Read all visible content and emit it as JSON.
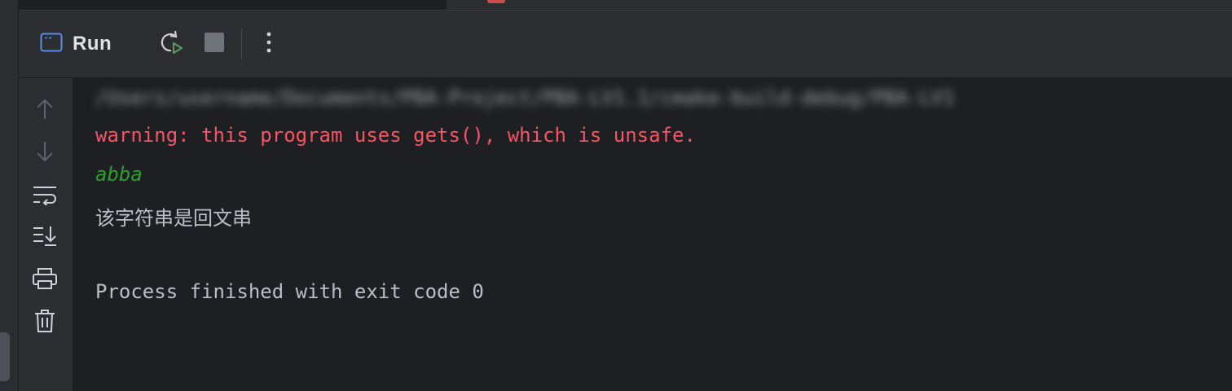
{
  "toolwindow": {
    "title": "Run",
    "icons": {
      "title": "console-window-icon",
      "rerun": "rerun-icon",
      "stop": "stop-icon",
      "more": "more-vertical-icon"
    }
  },
  "gutter": {
    "icons": [
      "arrow-up-icon",
      "arrow-down-icon",
      "soft-wrap-icon",
      "scroll-to-end-icon",
      "print-icon",
      "trash-icon"
    ]
  },
  "console": {
    "command_line": "/Users/username/Documents/PBA-Project/PBA-LV1.1/cmake-build-debug/PBA-LV1",
    "lines": {
      "warning": "warning: this program uses gets(), which is unsafe.",
      "input": "abba",
      "output": "该字符串是回文串",
      "exit": "Process finished with exit code 0"
    }
  },
  "colors": {
    "background": "#1e1f22",
    "panel": "#2b2d30",
    "warning": "#f75464",
    "input": "#2e9e2e",
    "text": "#bcbec4"
  }
}
